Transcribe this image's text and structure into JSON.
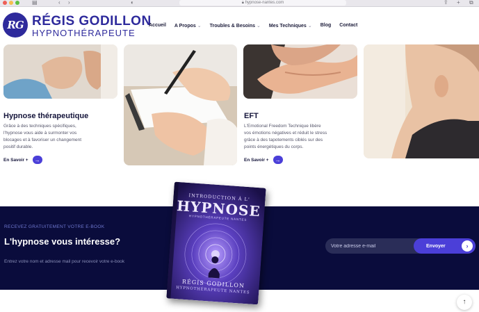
{
  "browser": {
    "url": "hypnose-nantes.com"
  },
  "header": {
    "logo_mark": "RG",
    "logo_name": "RÉGIS GODILLON",
    "logo_subtitle": "HYPNOTHÉRAPEUTE",
    "nav": [
      {
        "label": "Accueil",
        "has_menu": false
      },
      {
        "label": "A Propos",
        "has_menu": true
      },
      {
        "label": "Troubles & Besoins",
        "has_menu": true
      },
      {
        "label": "Mes Techniques",
        "has_menu": true
      },
      {
        "label": "Blog",
        "has_menu": false
      },
      {
        "label": "Contact",
        "has_menu": false
      }
    ]
  },
  "cards": [
    {
      "title": "Hypnose thérapeutique",
      "text_lines": [
        "Grâce à des techniques spécifiques,",
        "l'hypnose vous aide à surmonter vos",
        "blocages et à favoriser un changement",
        "positif durable."
      ],
      "more_label": "En Savoir +"
    },
    {
      "title": "EFT",
      "text_lines": [
        "L'Emotional Freedom Technique libère",
        "vos émotions négatives et réduit le stress",
        "grâce à des tapotements ciblés sur des",
        "points énergétiques du corps."
      ],
      "more_label": "En Savoir +"
    }
  ],
  "ebook": {
    "eyebrow": "RECEVEZ GRATUITEMENT VOTRE E-BOOK",
    "title": "L'hypnose vous intéresse?",
    "description": "Entrez votre nom et adresse mail pour recevoir votre e-book",
    "email_placeholder": "Votre adresse e-mail",
    "submit_label": "Envoyer",
    "book": {
      "title_top": "INTRODUCTION À L'",
      "title_main": "HYPNOSE",
      "title_sub": "HYPNOTHÉRAPEUTE NANTES",
      "author": "RÉGIS GODILLON",
      "author_sub": "HYPNOTHÉRAPEUTE NANTES"
    }
  },
  "colors": {
    "brand": "#2e2a9c",
    "accent": "#4b3fd8",
    "band_bg": "#0a0c3c"
  }
}
